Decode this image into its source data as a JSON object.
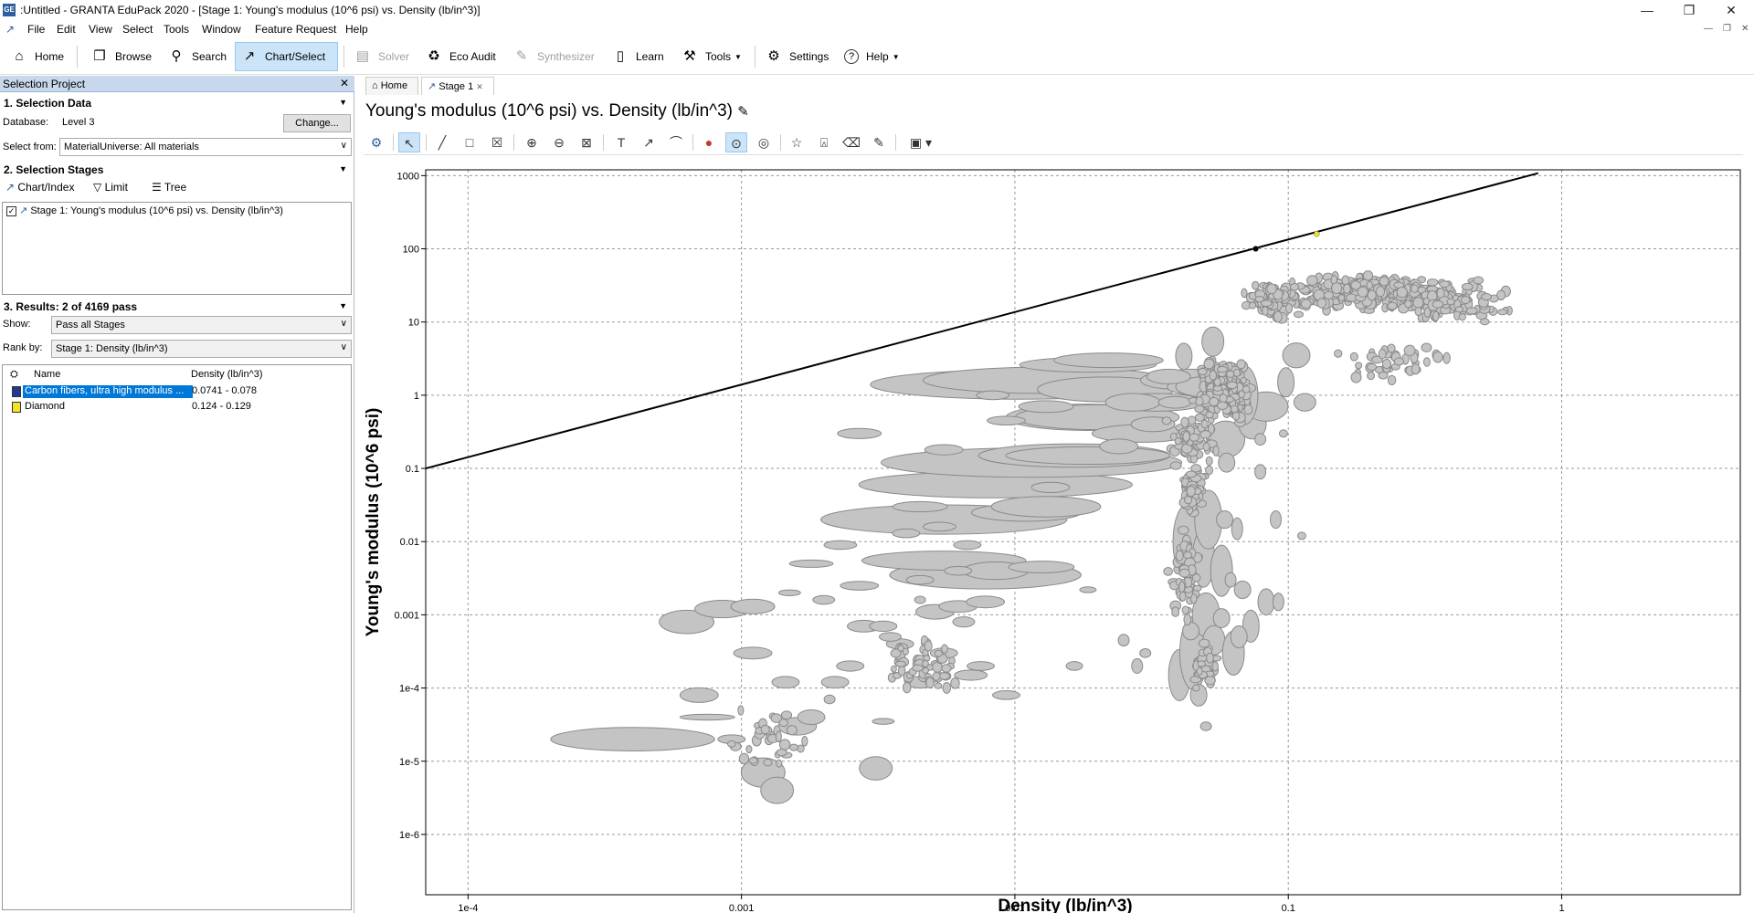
{
  "window": {
    "app_icon_text": "GE",
    "title": ":Untitled - GRANTA EduPack 2020 - [Stage 1: Young's modulus (10^6 psi) vs. Density (lb/in^3)]",
    "minimize": "—",
    "restore": "❐",
    "close": "✕"
  },
  "menu": {
    "items": [
      "File",
      "Edit",
      "View",
      "Select",
      "Tools",
      "Window",
      "Feature Request",
      "Help"
    ]
  },
  "toolbar": {
    "home": "Home",
    "browse": "Browse",
    "search": "Search",
    "chart_select": "Chart/Select",
    "solver": "Solver",
    "eco_audit": "Eco Audit",
    "synthesizer": "Synthesizer",
    "learn": "Learn",
    "tools": "Tools",
    "settings": "Settings",
    "help": "Help",
    "icons": {
      "home": "⌂",
      "browse": "❐",
      "search": "⚲",
      "chart": "↗",
      "solver": "▤",
      "eco": "♻",
      "synth": "✎",
      "learn": "▯",
      "tools": "⚒",
      "settings": "⚙",
      "help": "?"
    }
  },
  "left_panel": {
    "title": "Selection Project",
    "close": "✕",
    "section1": {
      "heading": "1. Selection Data",
      "database_label": "Database:",
      "database_value": "Level 3",
      "change_button": "Change...",
      "select_from_label": "Select from:",
      "select_from_value": "MaterialUniverse: All materials"
    },
    "section2": {
      "heading": "2. Selection Stages",
      "tools": [
        "Chart/Index",
        "Limit",
        "Tree"
      ],
      "stage": "Stage 1: Young's modulus (10^6 psi) vs. Density (lb/in^3)"
    },
    "section3": {
      "heading": "3. Results: 2 of 4169 pass",
      "show_label": "Show:",
      "show_value": "Pass all Stages",
      "rank_label": "Rank by:",
      "rank_value": "Stage 1: Density (lb/in^3)",
      "col_name": "Name",
      "col_density": "Density (lb/in^3)",
      "rows": [
        {
          "name": "Carbon fibers, ultra high modulus ...",
          "density": "0.0741 - 0.078",
          "color": "#1f3a93"
        },
        {
          "name": "Diamond",
          "density": "0.124 - 0.129",
          "color": "#f3e12b"
        }
      ]
    }
  },
  "doc_tabs": [
    "Home",
    "Stage 1"
  ],
  "chart_title": "Young's modulus (10^6 psi) vs. Density (lb/in^3)",
  "chart_data": {
    "type": "scatter",
    "xlabel": "Density (lb/in^3)",
    "ylabel": "Young's modulus (10^6 psi)",
    "x_scale": "log",
    "y_scale": "log",
    "xlim": [
      7e-05,
      4.5
    ],
    "ylim": [
      1.5e-07,
      1200
    ],
    "x_ticks": [
      {
        "v": 0.0001,
        "label": "1e-4"
      },
      {
        "v": 0.001,
        "label": "0.001"
      },
      {
        "v": 0.01,
        "label": "0.01"
      },
      {
        "v": 0.1,
        "label": "0.1"
      },
      {
        "v": 1,
        "label": "1"
      }
    ],
    "y_ticks": [
      {
        "v": 1000,
        "label": "1000"
      },
      {
        "v": 100,
        "label": "100"
      },
      {
        "v": 10,
        "label": "10"
      },
      {
        "v": 1,
        "label": "1"
      },
      {
        "v": 0.1,
        "label": "0.1"
      },
      {
        "v": 0.01,
        "label": "0.01"
      },
      {
        "v": 0.001,
        "label": "0.001"
      },
      {
        "v": 0.0001,
        "label": "1e-4"
      },
      {
        "v": 1e-05,
        "label": "1e-5"
      },
      {
        "v": 1e-06,
        "label": "1e-6"
      }
    ],
    "grid": true,
    "selection_line": {
      "points": [
        [
          7e-05,
          0.1
        ],
        [
          0.82,
          1080
        ]
      ]
    },
    "highlighted": [
      {
        "name": "Carbon fibers, ultra high modulus",
        "x": 0.076,
        "y": 100,
        "color": "#000000"
      },
      {
        "name": "Diamond",
        "x": 0.127,
        "y": 160,
        "color": "#f3e12b"
      }
    ],
    "bubbles": [
      {
        "x": 0.0004,
        "y": 2e-05,
        "rx": 0.3,
        "ry": 0.16
      },
      {
        "x": 0.00063,
        "y": 0.0008,
        "rx": 0.1,
        "ry": 0.16
      },
      {
        "x": 0.00085,
        "y": 0.0012,
        "rx": 0.1,
        "ry": 0.12
      },
      {
        "x": 0.0011,
        "y": 0.0013,
        "rx": 0.08,
        "ry": 0.1
      },
      {
        "x": 0.00075,
        "y": 4e-05,
        "rx": 0.1,
        "ry": 0.04
      },
      {
        "x": 0.0007,
        "y": 8e-05,
        "rx": 0.07,
        "ry": 0.1
      },
      {
        "x": 0.0011,
        "y": 0.0003,
        "rx": 0.07,
        "ry": 0.08
      },
      {
        "x": 0.00092,
        "y": 2e-05,
        "rx": 0.05,
        "ry": 0.06
      },
      {
        "x": 0.0012,
        "y": 7e-06,
        "rx": 0.08,
        "ry": 0.2
      },
      {
        "x": 0.00135,
        "y": 4e-06,
        "rx": 0.06,
        "ry": 0.18
      },
      {
        "x": 0.0016,
        "y": 3e-05,
        "rx": 0.07,
        "ry": 0.12
      },
      {
        "x": 0.0018,
        "y": 4e-05,
        "rx": 0.05,
        "ry": 0.1
      },
      {
        "x": 0.00145,
        "y": 0.00012,
        "rx": 0.05,
        "ry": 0.08
      },
      {
        "x": 0.0022,
        "y": 0.00012,
        "rx": 0.05,
        "ry": 0.08
      },
      {
        "x": 0.0025,
        "y": 0.0002,
        "rx": 0.05,
        "ry": 0.07
      },
      {
        "x": 0.0031,
        "y": 8e-06,
        "rx": 0.06,
        "ry": 0.16
      },
      {
        "x": 0.0028,
        "y": 0.0007,
        "rx": 0.06,
        "ry": 0.08
      },
      {
        "x": 0.0038,
        "y": 0.0004,
        "rx": 0.05,
        "ry": 0.07
      },
      {
        "x": 0.0045,
        "y": 0.00012,
        "rx": 0.05,
        "ry": 0.08
      },
      {
        "x": 0.0051,
        "y": 0.0011,
        "rx": 0.07,
        "ry": 0.1
      },
      {
        "x": 0.0055,
        "y": 0.0003,
        "rx": 0.05,
        "ry": 0.07
      },
      {
        "x": 0.0062,
        "y": 0.0013,
        "rx": 0.07,
        "ry": 0.08
      },
      {
        "x": 0.0069,
        "y": 0.00015,
        "rx": 0.06,
        "ry": 0.07
      },
      {
        "x": 0.0075,
        "y": 0.0002,
        "rx": 0.05,
        "ry": 0.06
      },
      {
        "x": 0.0078,
        "y": 0.0015,
        "rx": 0.07,
        "ry": 0.08
      },
      {
        "x": 0.0078,
        "y": 0.0035,
        "rx": 0.35,
        "ry": 0.19
      },
      {
        "x": 0.0055,
        "y": 0.0055,
        "rx": 0.3,
        "ry": 0.13
      },
      {
        "x": 0.0085,
        "y": 0.004,
        "rx": 0.12,
        "ry": 0.12
      },
      {
        "x": 0.0055,
        "y": 0.02,
        "rx": 0.45,
        "ry": 0.2
      },
      {
        "x": 0.011,
        "y": 0.025,
        "rx": 0.2,
        "ry": 0.12
      },
      {
        "x": 0.0085,
        "y": 0.06,
        "rx": 0.5,
        "ry": 0.18
      },
      {
        "x": 0.0115,
        "y": 0.12,
        "rx": 0.55,
        "ry": 0.2
      },
      {
        "x": 0.013,
        "y": 0.03,
        "rx": 0.2,
        "ry": 0.14
      },
      {
        "x": 0.0165,
        "y": 0.15,
        "rx": 0.35,
        "ry": 0.16
      },
      {
        "x": 0.0185,
        "y": 0.15,
        "rx": 0.3,
        "ry": 0.12
      },
      {
        "x": 0.0105,
        "y": 1.4,
        "rx": 0.55,
        "ry": 0.2
      },
      {
        "x": 0.013,
        "y": 1.6,
        "rx": 0.45,
        "ry": 0.18
      },
      {
        "x": 0.0185,
        "y": 0.5,
        "rx": 0.3,
        "ry": 0.18
      },
      {
        "x": 0.02,
        "y": 0.5,
        "rx": 0.3,
        "ry": 0.17
      },
      {
        "x": 0.0215,
        "y": 1.2,
        "rx": 0.25,
        "ry": 0.17
      },
      {
        "x": 0.0185,
        "y": 2.6,
        "rx": 0.25,
        "ry": 0.1
      },
      {
        "x": 0.022,
        "y": 3,
        "rx": 0.2,
        "ry": 0.1
      },
      {
        "x": 0.029,
        "y": 0.3,
        "rx": 0.18,
        "ry": 0.12
      },
      {
        "x": 0.033,
        "y": 0.8,
        "rx": 0.18,
        "ry": 0.12
      },
      {
        "x": 0.038,
        "y": 1.6,
        "rx": 0.12,
        "ry": 0.12
      },
      {
        "x": 0.044,
        "y": 1.8,
        "rx": 0.1,
        "ry": 0.1
      },
      {
        "x": 0.0465,
        "y": 1.3,
        "rx": 0.11,
        "ry": 0.11
      },
      {
        "x": 0.0535,
        "y": 1.3,
        "rx": 0.14,
        "ry": 0.15
      },
      {
        "x": 0.0425,
        "y": 0.01,
        "rx": 0.05,
        "ry": 0.5
      },
      {
        "x": 0.049,
        "y": 0.006,
        "rx": 0.04,
        "ry": 0.4
      },
      {
        "x": 0.057,
        "y": 0.004,
        "rx": 0.04,
        "ry": 0.35
      },
      {
        "x": 0.04,
        "y": 0.00015,
        "rx": 0.04,
        "ry": 0.35
      },
      {
        "x": 0.045,
        "y": 0.0003,
        "rx": 0.05,
        "ry": 0.5
      },
      {
        "x": 0.05,
        "y": 0.001,
        "rx": 0.05,
        "ry": 0.3
      },
      {
        "x": 0.0535,
        "y": 0.00045,
        "rx": 0.04,
        "ry": 0.2
      },
      {
        "x": 0.063,
        "y": 0.0003,
        "rx": 0.04,
        "ry": 0.3
      },
      {
        "x": 0.073,
        "y": 0.0007,
        "rx": 0.03,
        "ry": 0.22
      },
      {
        "x": 0.083,
        "y": 0.0015,
        "rx": 0.03,
        "ry": 0.18
      },
      {
        "x": 0.092,
        "y": 0.0015,
        "rx": 0.02,
        "ry": 0.12
      },
      {
        "x": 0.051,
        "y": 0.02,
        "rx": 0.05,
        "ry": 0.4
      },
      {
        "x": 0.065,
        "y": 0.015,
        "rx": 0.02,
        "ry": 0.15
      },
      {
        "x": 0.09,
        "y": 0.02,
        "rx": 0.02,
        "ry": 0.12
      },
      {
        "x": 0.059,
        "y": 0.25,
        "rx": 0.07,
        "ry": 0.25
      },
      {
        "x": 0.079,
        "y": 0.09,
        "rx": 0.02,
        "ry": 0.1
      },
      {
        "x": 0.074,
        "y": 0.4,
        "rx": 0.05,
        "ry": 0.2
      },
      {
        "x": 0.083,
        "y": 0.7,
        "rx": 0.08,
        "ry": 0.2
      },
      {
        "x": 0.069,
        "y": 1.0,
        "rx": 0.05,
        "ry": 0.4
      },
      {
        "x": 0.098,
        "y": 1.5,
        "rx": 0.03,
        "ry": 0.2
      },
      {
        "x": 0.107,
        "y": 3.5,
        "rx": 0.05,
        "ry": 0.17
      },
      {
        "x": 0.115,
        "y": 0.8,
        "rx": 0.04,
        "ry": 0.12
      },
      {
        "x": 0.0365,
        "y": 1.8,
        "rx": 0.08,
        "ry": 0.1
      },
      {
        "x": 0.0125,
        "y": 0.0045,
        "rx": 0.12,
        "ry": 0.08
      },
      {
        "x": 0.0135,
        "y": 0.055,
        "rx": 0.07,
        "ry": 0.07
      },
      {
        "x": 0.028,
        "y": 0.0002,
        "rx": 0.02,
        "ry": 0.1
      },
      {
        "x": 0.025,
        "y": 0.00045,
        "rx": 0.02,
        "ry": 0.08
      },
      {
        "x": 0.0165,
        "y": 0.0002,
        "rx": 0.03,
        "ry": 0.06
      },
      {
        "x": 0.03,
        "y": 0.0003,
        "rx": 0.02,
        "ry": 0.06
      },
      {
        "x": 0.05,
        "y": 3e-05,
        "rx": 0.02,
        "ry": 0.06
      },
      {
        "x": 0.0093,
        "y": 8e-05,
        "rx": 0.05,
        "ry": 0.06
      },
      {
        "x": 0.0033,
        "y": 0.0007,
        "rx": 0.05,
        "ry": 0.07
      },
      {
        "x": 0.0045,
        "y": 0.003,
        "rx": 0.05,
        "ry": 0.06
      },
      {
        "x": 0.0023,
        "y": 0.009,
        "rx": 0.06,
        "ry": 0.06
      },
      {
        "x": 0.0018,
        "y": 0.005,
        "rx": 0.08,
        "ry": 0.05
      },
      {
        "x": 0.0027,
        "y": 0.0025,
        "rx": 0.07,
        "ry": 0.06
      },
      {
        "x": 0.002,
        "y": 0.0016,
        "rx": 0.04,
        "ry": 0.06
      },
      {
        "x": 0.0035,
        "y": 0.0005,
        "rx": 0.04,
        "ry": 0.06
      },
      {
        "x": 0.0065,
        "y": 0.0008,
        "rx": 0.04,
        "ry": 0.07
      },
      {
        "x": 0.0062,
        "y": 0.004,
        "rx": 0.05,
        "ry": 0.06
      },
      {
        "x": 0.0067,
        "y": 0.009,
        "rx": 0.05,
        "ry": 0.06
      },
      {
        "x": 0.004,
        "y": 0.013,
        "rx": 0.05,
        "ry": 0.06
      },
      {
        "x": 0.0053,
        "y": 0.016,
        "rx": 0.06,
        "ry": 0.06
      },
      {
        "x": 0.0045,
        "y": 0.03,
        "rx": 0.1,
        "ry": 0.07
      },
      {
        "x": 0.0027,
        "y": 0.3,
        "rx": 0.08,
        "ry": 0.07
      },
      {
        "x": 0.0055,
        "y": 0.18,
        "rx": 0.07,
        "ry": 0.07
      },
      {
        "x": 0.0093,
        "y": 0.45,
        "rx": 0.07,
        "ry": 0.06
      },
      {
        "x": 0.0083,
        "y": 1.0,
        "rx": 0.06,
        "ry": 0.06
      },
      {
        "x": 0.013,
        "y": 0.7,
        "rx": 0.1,
        "ry": 0.08
      },
      {
        "x": 0.024,
        "y": 0.2,
        "rx": 0.07,
        "ry": 0.1
      },
      {
        "x": 0.027,
        "y": 0.8,
        "rx": 0.1,
        "ry": 0.12
      },
      {
        "x": 0.032,
        "y": 0.4,
        "rx": 0.08,
        "ry": 0.1
      },
      {
        "x": 0.0385,
        "y": 0.8,
        "rx": 0.06,
        "ry": 0.08
      },
      {
        "x": 0.0415,
        "y": 3.4,
        "rx": 0.03,
        "ry": 0.18
      },
      {
        "x": 0.053,
        "y": 5.4,
        "rx": 0.04,
        "ry": 0.2
      },
      {
        "x": 0.0585,
        "y": 0.02,
        "rx": 0.03,
        "ry": 0.12
      },
      {
        "x": 0.0615,
        "y": 0.003,
        "rx": 0.02,
        "ry": 0.1
      },
      {
        "x": 0.066,
        "y": 0.0005,
        "rx": 0.03,
        "ry": 0.15
      },
      {
        "x": 0.047,
        "y": 8e-05,
        "rx": 0.03,
        "ry": 0.15
      },
      {
        "x": 0.044,
        "y": 0.0006,
        "rx": 0.03,
        "ry": 0.12
      },
      {
        "x": 0.057,
        "y": 0.0009,
        "rx": 0.03,
        "ry": 0.13
      },
      {
        "x": 0.068,
        "y": 0.0022,
        "rx": 0.03,
        "ry": 0.12
      },
      {
        "x": 0.0595,
        "y": 0.12,
        "rx": 0.03,
        "ry": 0.13
      },
      {
        "x": 0.079,
        "y": 0.25,
        "rx": 0.02,
        "ry": 0.08
      },
      {
        "x": 0.096,
        "y": 0.3,
        "rx": 0.015,
        "ry": 0.05
      },
      {
        "x": 0.112,
        "y": 0.012,
        "rx": 0.015,
        "ry": 0.05
      },
      {
        "x": 0.0185,
        "y": 0.0022,
        "rx": 0.03,
        "ry": 0.04
      },
      {
        "x": 0.0045,
        "y": 0.0016,
        "rx": 0.02,
        "ry": 0.05
      },
      {
        "x": 0.0015,
        "y": 0.002,
        "rx": 0.04,
        "ry": 0.04
      },
      {
        "x": 0.0033,
        "y": 3.5e-05,
        "rx": 0.04,
        "ry": 0.04
      },
      {
        "x": 0.0021,
        "y": 7e-05,
        "rx": 0.02,
        "ry": 0.06
      }
    ],
    "cloud": [
      {
        "cx": 0.2,
        "cy": 25,
        "sx": 0.32,
        "sy": 0.22,
        "n": 260
      },
      {
        "cx": 0.085,
        "cy": 20,
        "sx": 0.08,
        "sy": 0.22,
        "n": 80
      },
      {
        "cx": 0.4,
        "cy": 18,
        "sx": 0.18,
        "sy": 0.2,
        "n": 90
      },
      {
        "cx": 0.058,
        "cy": 1.2,
        "sx": 0.08,
        "sy": 0.35,
        "n": 240
      },
      {
        "cx": 0.045,
        "cy": 0.25,
        "sx": 0.08,
        "sy": 0.3,
        "n": 70
      },
      {
        "cx": 0.042,
        "cy": 0.003,
        "sx": 0.05,
        "sy": 0.5,
        "n": 70
      },
      {
        "cx": 0.05,
        "cy": 0.0002,
        "sx": 0.04,
        "sy": 0.35,
        "n": 40
      },
      {
        "cx": 0.0045,
        "cy": 0.0002,
        "sx": 0.12,
        "sy": 0.35,
        "n": 60
      },
      {
        "cx": 0.0013,
        "cy": 2e-05,
        "sx": 0.12,
        "sy": 0.4,
        "n": 35
      },
      {
        "cx": 0.045,
        "cy": 0.05,
        "sx": 0.05,
        "sy": 0.35,
        "n": 50
      },
      {
        "cx": 0.25,
        "cy": 3,
        "sx": 0.18,
        "sy": 0.25,
        "n": 40
      }
    ]
  }
}
